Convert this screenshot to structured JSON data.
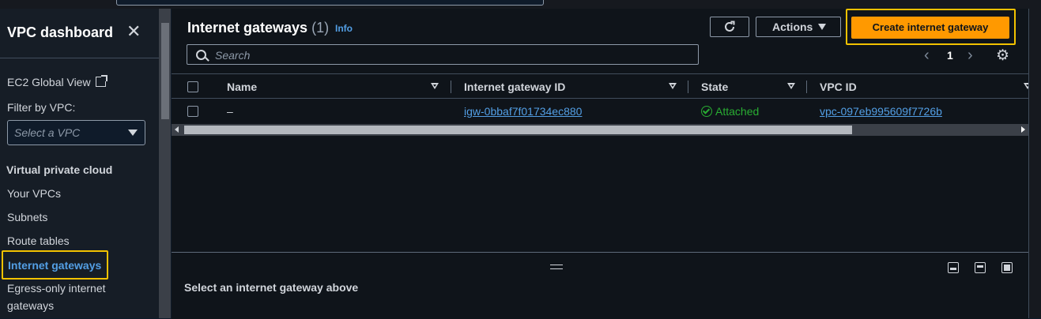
{
  "sidebar": {
    "title": "VPC dashboard",
    "ec2_global_view": "EC2 Global View",
    "filter_label": "Filter by VPC:",
    "filter_placeholder": "Select a VPC",
    "section_title": "Virtual private cloud",
    "items": [
      {
        "label": "Your VPCs"
      },
      {
        "label": "Subnets"
      },
      {
        "label": "Route tables"
      },
      {
        "label": "Internet gateways",
        "active": true
      },
      {
        "label": "Egress-only internet"
      },
      {
        "label": "gateways"
      }
    ]
  },
  "header": {
    "title": "Internet gateways",
    "count": "(1)",
    "info": "Info",
    "actions_label": "Actions",
    "create_label": "Create internet gateway",
    "accent_color": "#ff9900"
  },
  "search": {
    "placeholder": "Search"
  },
  "pagination": {
    "page": "1"
  },
  "table": {
    "columns": [
      "Name",
      "Internet gateway ID",
      "State",
      "VPC ID"
    ],
    "rows": [
      {
        "name": "–",
        "id": "igw-0bbaf7f01734ec880",
        "state": "Attached",
        "vpc_id": "vpc-097eb995609f7726b"
      }
    ]
  },
  "details": {
    "message": "Select an internet gateway above"
  },
  "colors": {
    "link": "#539fe5",
    "success": "#29ad32",
    "highlight": "#f2c200"
  }
}
